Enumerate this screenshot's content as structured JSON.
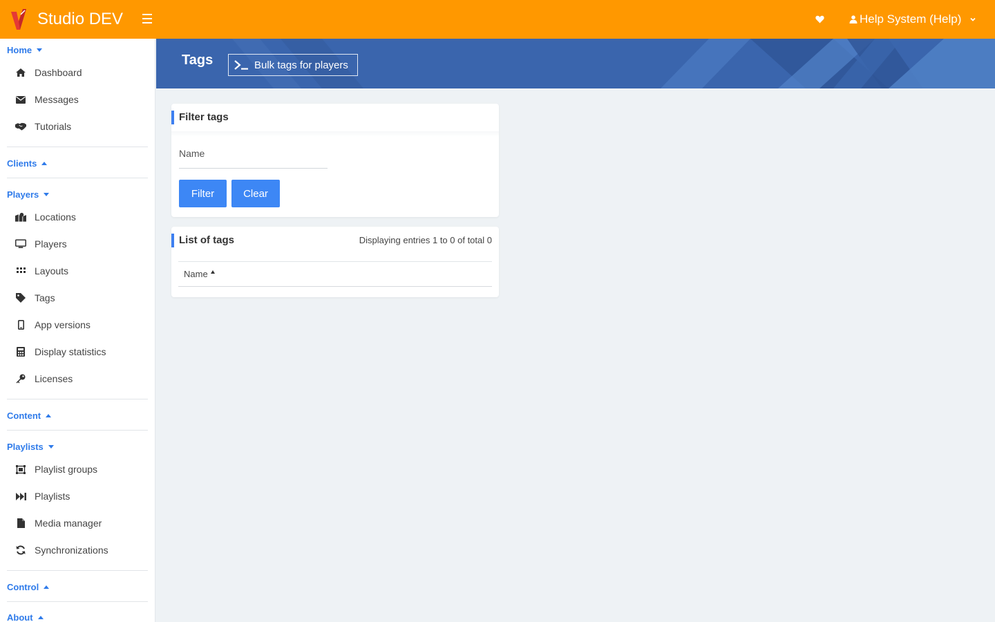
{
  "app": {
    "brand": "Studio DEV",
    "user_label": "Help System (Help)"
  },
  "colors": {
    "topbar": "#ff9800",
    "accent": "#3d87f5",
    "banner": "#3a65ad",
    "section_link": "#2f7bea"
  },
  "sidebar": {
    "sections": [
      {
        "label": "Home",
        "expanded": true,
        "items": [
          {
            "label": "Dashboard",
            "icon": "home-icon"
          },
          {
            "label": "Messages",
            "icon": "envelope-icon"
          },
          {
            "label": "Tutorials",
            "icon": "handshake-icon"
          }
        ]
      },
      {
        "label": "Clients",
        "expanded": false,
        "items": []
      },
      {
        "label": "Players",
        "expanded": true,
        "items": [
          {
            "label": "Locations",
            "icon": "map-marker-icon"
          },
          {
            "label": "Players",
            "icon": "monitor-icon"
          },
          {
            "label": "Layouts",
            "icon": "grid-icon"
          },
          {
            "label": "Tags",
            "icon": "tag-icon"
          },
          {
            "label": "App versions",
            "icon": "mobile-icon"
          },
          {
            "label": "Display statistics",
            "icon": "calculator-icon"
          },
          {
            "label": "Licenses",
            "icon": "key-icon"
          }
        ]
      },
      {
        "label": "Content",
        "expanded": false,
        "items": []
      },
      {
        "label": "Playlists",
        "expanded": true,
        "items": [
          {
            "label": "Playlist groups",
            "icon": "object-group-icon"
          },
          {
            "label": "Playlists",
            "icon": "fast-forward-icon"
          },
          {
            "label": "Media manager",
            "icon": "file-icon"
          },
          {
            "label": "Synchronizations",
            "icon": "sync-icon"
          }
        ]
      },
      {
        "label": "Control",
        "expanded": false,
        "items": []
      },
      {
        "label": "About",
        "expanded": false,
        "items": []
      }
    ]
  },
  "page": {
    "title": "Tags",
    "bulk_button": "Bulk tags for players"
  },
  "filter": {
    "title": "Filter tags",
    "name_placeholder": "Name",
    "filter_label": "Filter",
    "clear_label": "Clear"
  },
  "list": {
    "title": "List of tags",
    "entries": "Displaying entries 1 to 0 of total 0",
    "columns": [
      "Name"
    ]
  }
}
